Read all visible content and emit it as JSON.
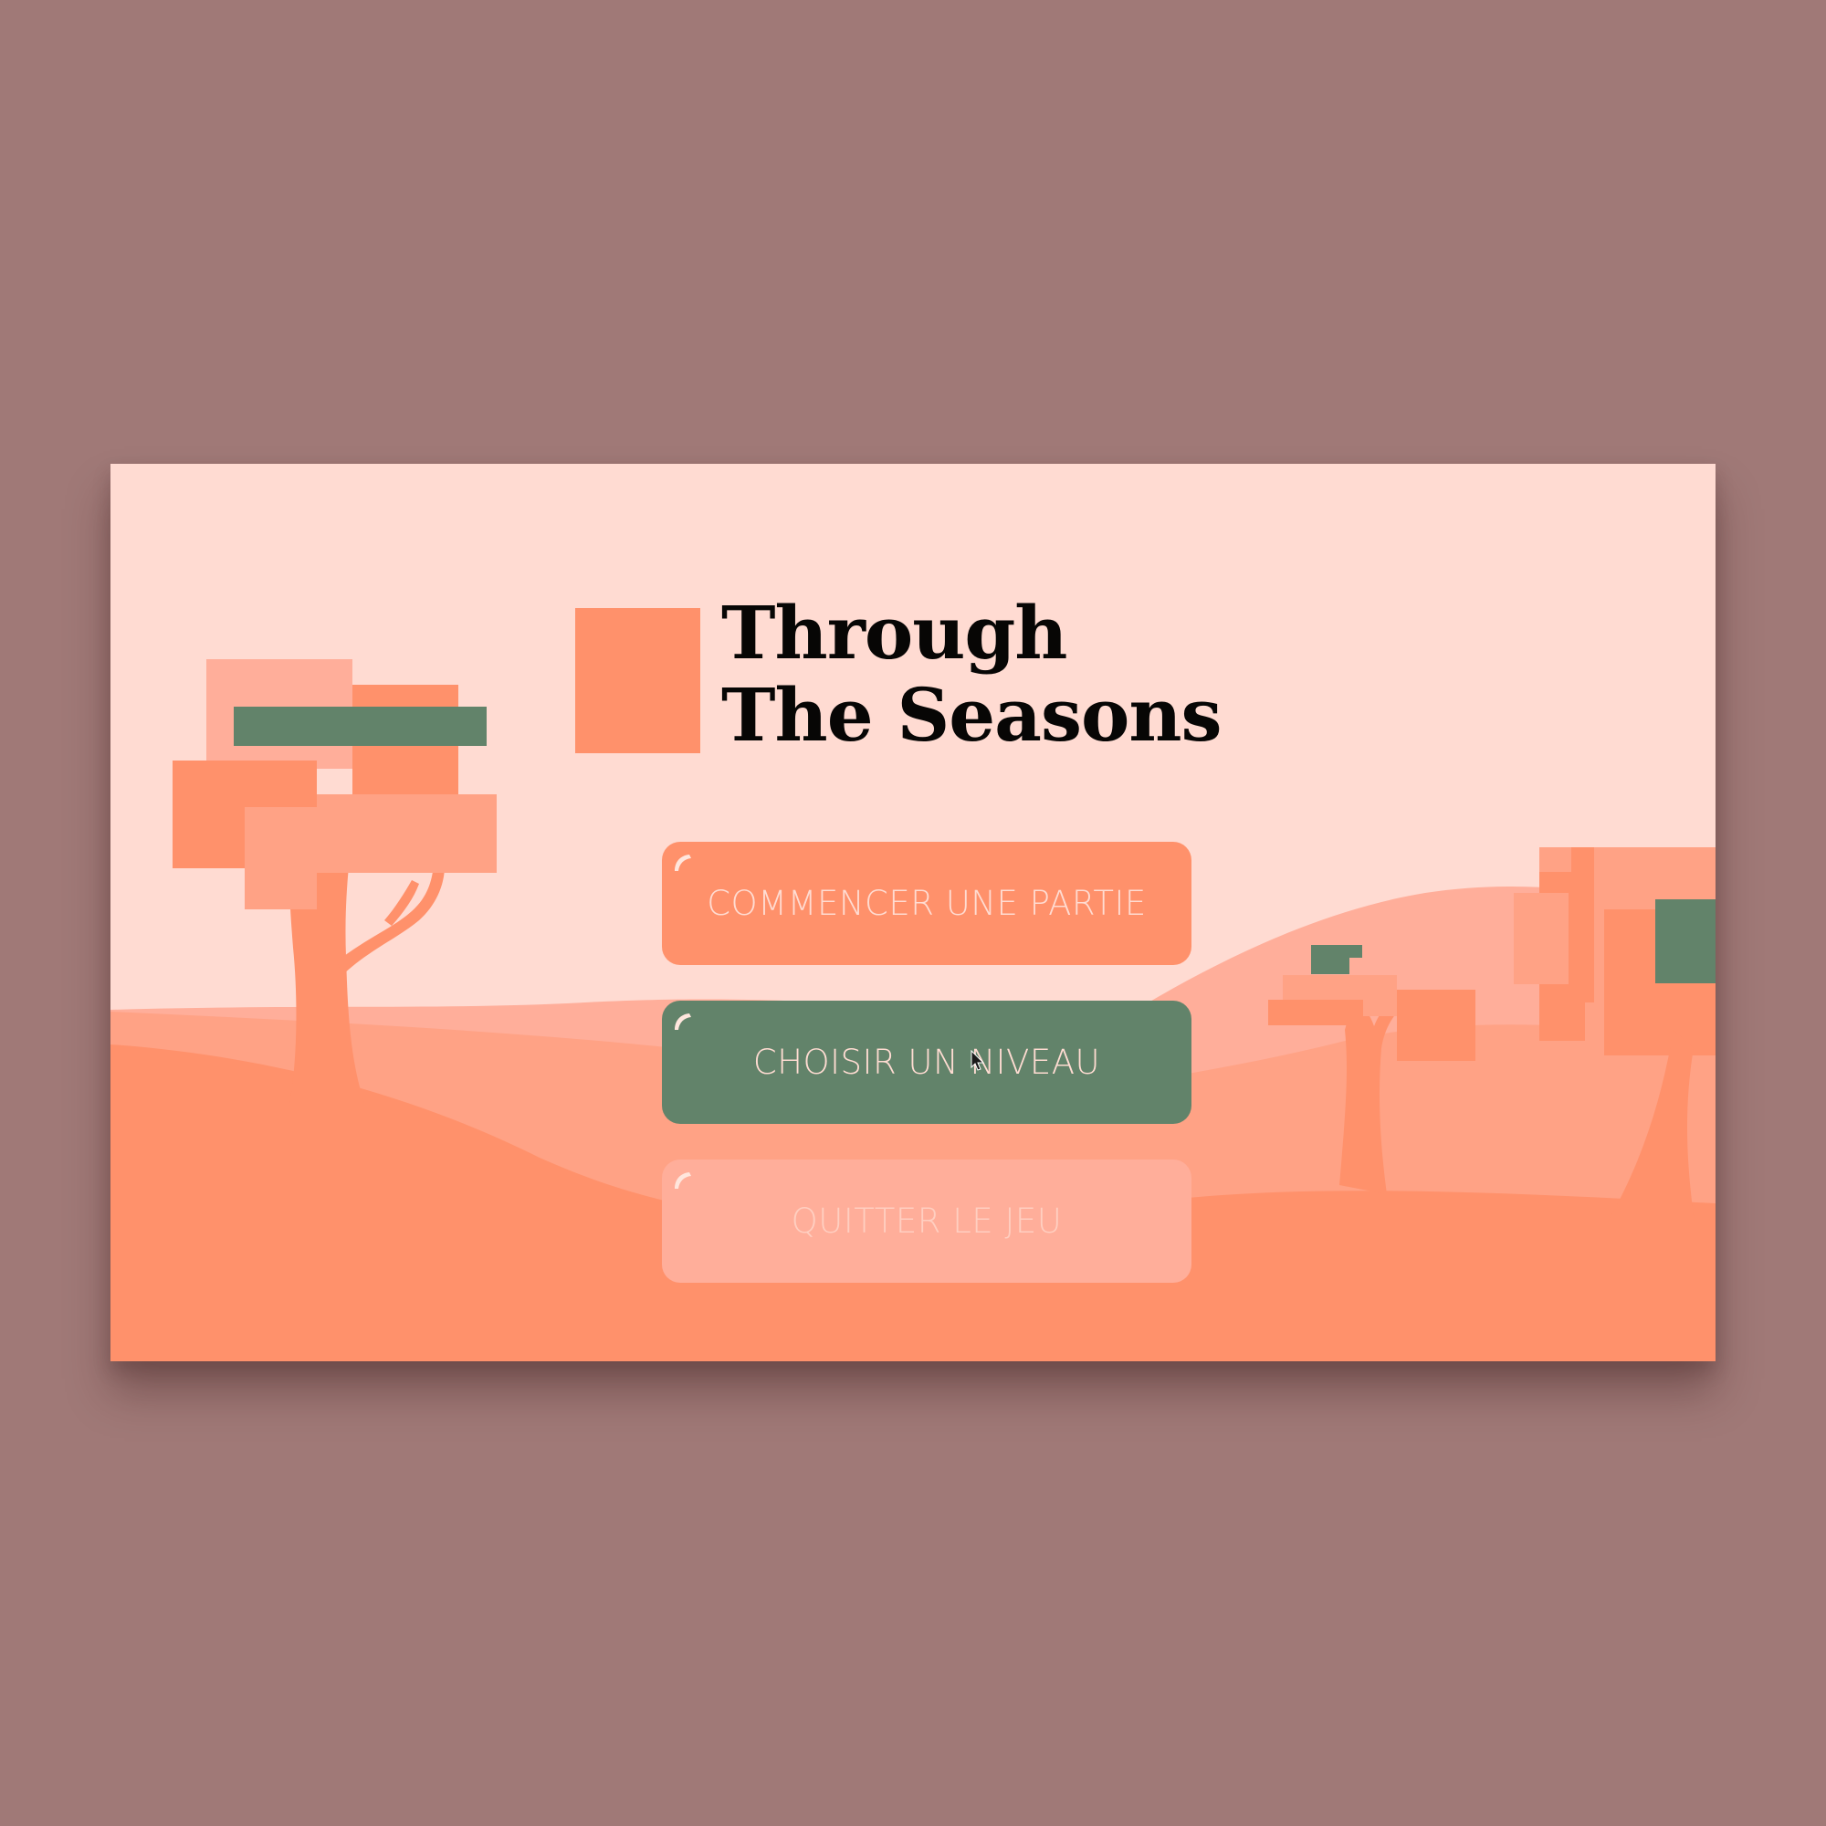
{
  "title": {
    "line1": "Through",
    "line2": "The Seasons"
  },
  "menu": {
    "start_label": "COMMENCER UNE PARTIE",
    "levels_label": "CHOISIR UN NIVEAU",
    "quit_label": "QUITTER LE JEU"
  },
  "colors": {
    "backdrop": "#a07977",
    "sky": "#ffdbd2",
    "accent_orange": "#ff916b",
    "accent_green": "#62836a",
    "soft_peach": "#ffae9a"
  }
}
